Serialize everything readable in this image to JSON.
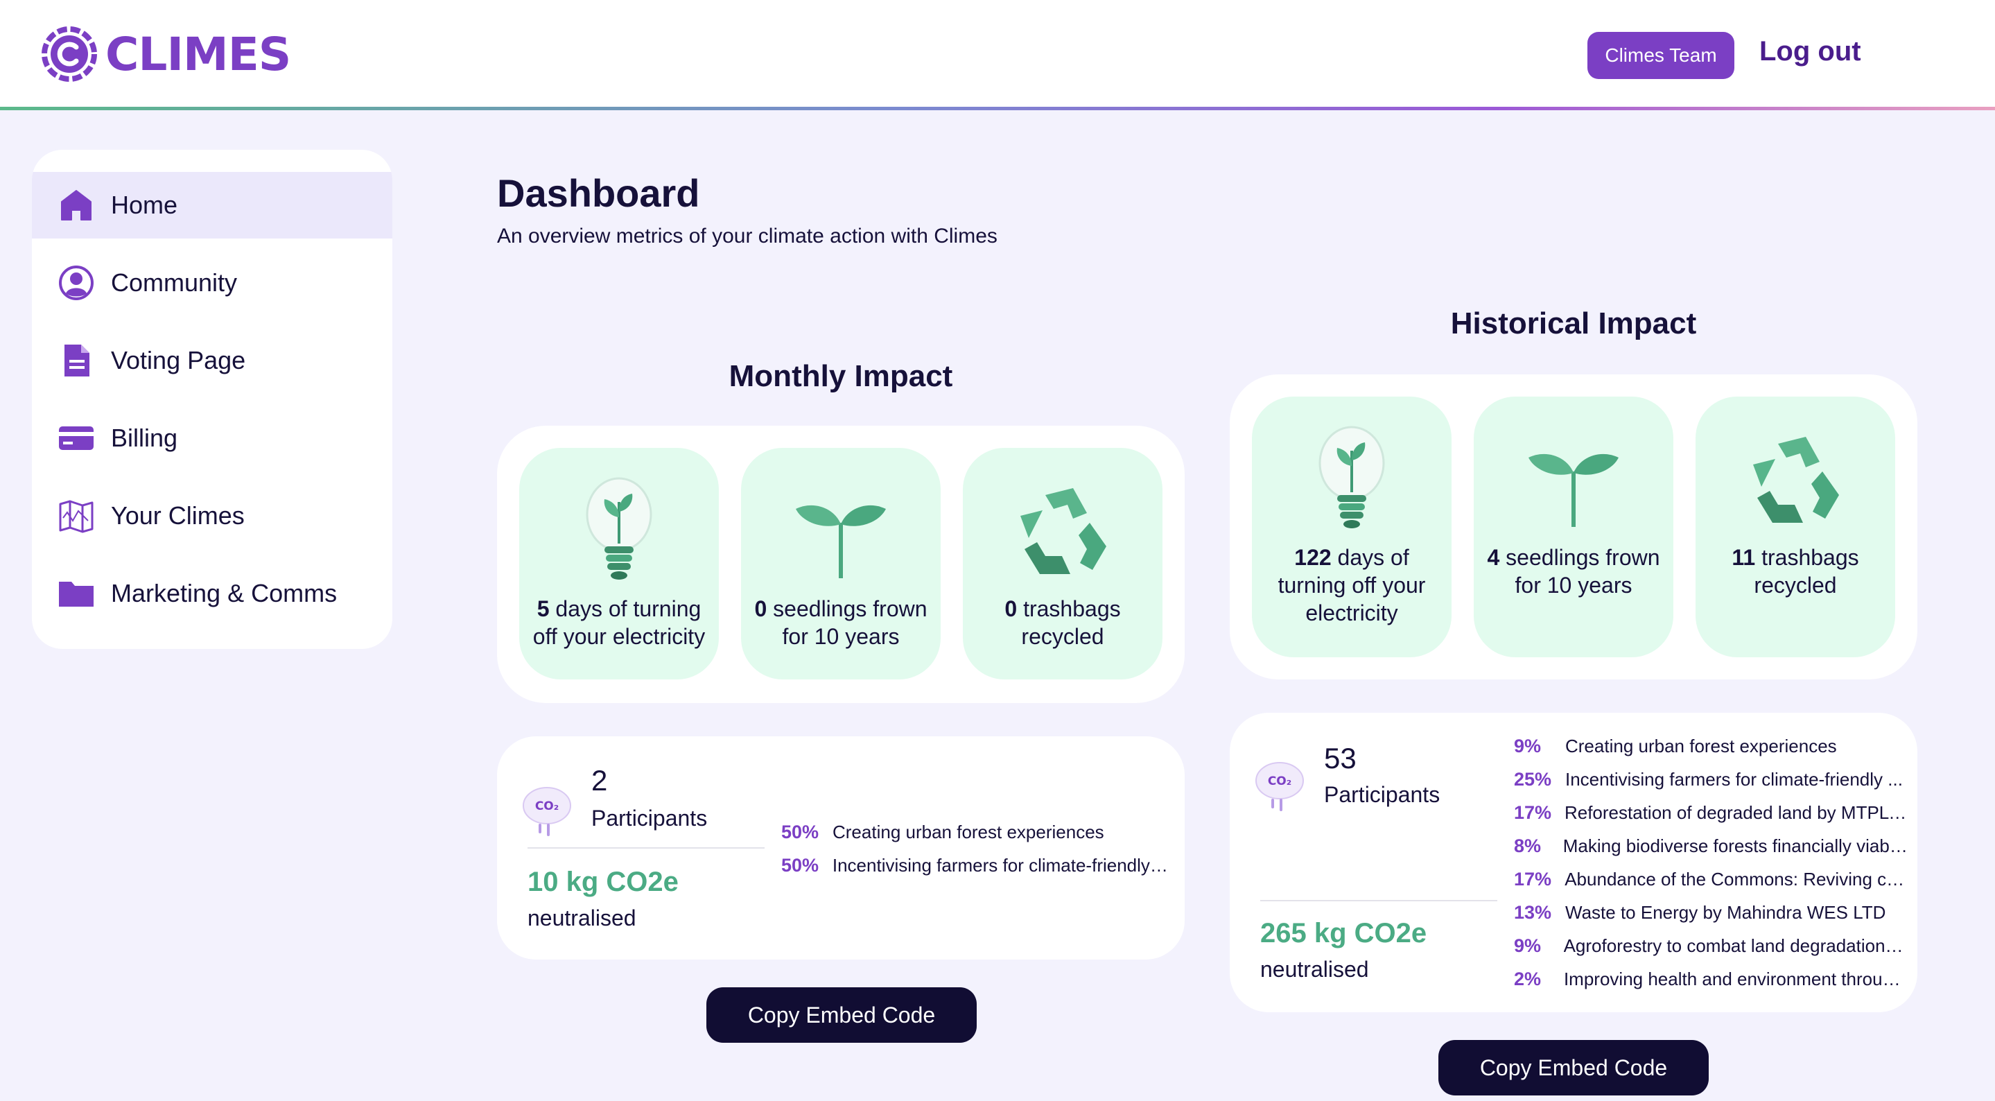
{
  "header": {
    "logo_text": "CLIMES",
    "team_button": "Climes Team",
    "logout": "Log out"
  },
  "sidebar": {
    "items": [
      {
        "label": "Home",
        "icon": "home-icon"
      },
      {
        "label": "Community",
        "icon": "user-circle-icon"
      },
      {
        "label": "Voting Page",
        "icon": "document-icon"
      },
      {
        "label": "Billing",
        "icon": "credit-card-icon"
      },
      {
        "label": "Your Climes",
        "icon": "map-icon"
      },
      {
        "label": "Marketing & Comms",
        "icon": "folder-icon"
      }
    ]
  },
  "main": {
    "title": "Dashboard",
    "subtitle": "An overview metrics of your climate action with Climes"
  },
  "monthly": {
    "title": "Monthly Impact",
    "tiles": [
      {
        "value": "5",
        "text": " days of turning off your electricity",
        "icon": "lightbulb-plant-icon"
      },
      {
        "value": "0",
        "text": " seedlings frown for 10 years",
        "icon": "seedling-icon"
      },
      {
        "value": "0",
        "text": " trashbags recycled",
        "icon": "recycle-icon"
      }
    ],
    "participants_count": "2",
    "participants_label": "Participants",
    "co2": "10 kg CO2e",
    "co2_label": "neutralised",
    "projects": [
      {
        "pct": "50%",
        "name": "Creating urban forest experiences"
      },
      {
        "pct": "50%",
        "name": "Incentivising farmers for climate-friendly ..."
      }
    ],
    "embed_button": "Copy Embed Code"
  },
  "historical": {
    "title": "Historical Impact",
    "tiles": [
      {
        "value": "122",
        "text": " days of turning off your electricity",
        "icon": "lightbulb-plant-icon"
      },
      {
        "value": "4",
        "text": " seedlings frown for 10 years",
        "icon": "seedling-icon"
      },
      {
        "value": "11",
        "text": " trashbags recycled",
        "icon": "recycle-icon"
      }
    ],
    "participants_count": "53",
    "participants_label": "Participants",
    "co2": "265 kg CO2e",
    "co2_label": "neutralised",
    "projects": [
      {
        "pct": "9%",
        "name": "Creating urban forest experiences"
      },
      {
        "pct": "25%",
        "name": "Incentivising farmers for climate-friendly ..."
      },
      {
        "pct": "17%",
        "name": "Reforestation of degraded land by MTPL i..."
      },
      {
        "pct": "8%",
        "name": "Making biodiverse forests financially viable ..."
      },
      {
        "pct": "17%",
        "name": "Abundance of the Commons: Reviving co..."
      },
      {
        "pct": "13%",
        "name": "Waste to Energy by Mahindra WES LTD"
      },
      {
        "pct": "9%",
        "name": "Agroforestry to combat land degradation in..."
      },
      {
        "pct": "2%",
        "name": "Improving health and environment through..."
      }
    ],
    "embed_button": "Copy Embed Code"
  },
  "colors": {
    "brand": "#7b3fc4",
    "dark": "#110d33",
    "green": "#4bab84",
    "tile_bg": "#e2fbee",
    "page_bg": "#f3f2fd"
  }
}
